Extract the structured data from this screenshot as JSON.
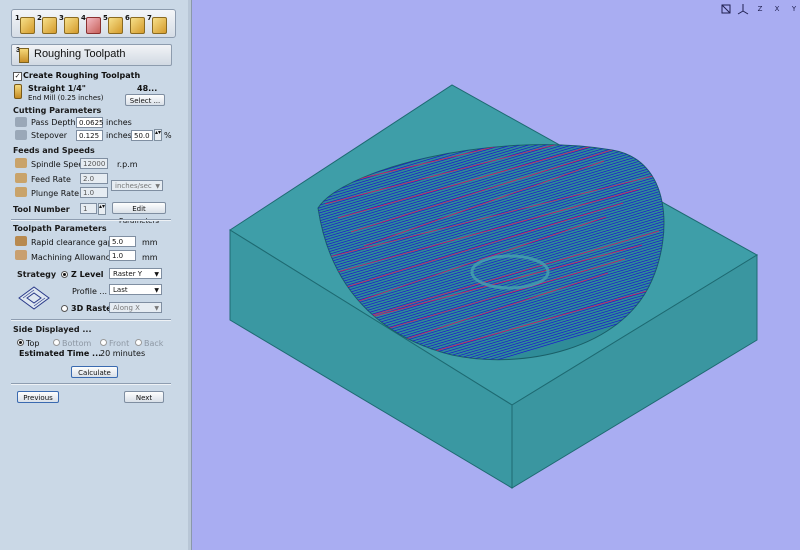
{
  "wizard": {
    "steps": [
      "1",
      "2",
      "3",
      "4",
      "5",
      "6",
      "7"
    ],
    "title_step": "3",
    "title": "Roughing Toolpath"
  },
  "create": {
    "label": "Create Roughing Toolpath",
    "checked": true
  },
  "tool": {
    "name": "Straight 1/4\"",
    "number_display": "48...",
    "type": "End Mill (0.25 inches)",
    "select_label": "Select ..."
  },
  "cutting": {
    "header": "Cutting Parameters",
    "pass_depth_label": "Pass Depth",
    "pass_depth": "0.0625",
    "pass_depth_unit": "inches",
    "stepover_label": "Stepover",
    "stepover": "0.125",
    "stepover_unit": "inches",
    "stepover_pct": "50.0",
    "pct_symbol": "%"
  },
  "feeds": {
    "header": "Feeds and Speeds",
    "spindle_label": "Spindle Speed",
    "spindle": "12000",
    "spindle_unit": "r.p.m",
    "feed_label": "Feed Rate",
    "feed": "2.0",
    "plunge_label": "Plunge Rate",
    "plunge": "1.0",
    "rate_unit": "inches/sec",
    "tool_number_label": "Tool Number",
    "tool_number": "1",
    "edit_params": "Edit Parameters"
  },
  "toolpath": {
    "header": "Toolpath Parameters",
    "rapid_label": "Rapid clearance gap",
    "rapid": "5.0",
    "rapid_unit": "mm",
    "allowance_label": "Machining Allowance",
    "allowance": "1.0",
    "allowance_unit": "mm"
  },
  "strategy": {
    "label": "Strategy",
    "zlevel_label": "Z Level",
    "zlevel_value": "Raster Y",
    "profile_label": "Profile ...",
    "profile_value": "Last",
    "raster3d_label": "3D Raster",
    "raster3d_value": "Along X",
    "selected": "Z Level"
  },
  "side": {
    "header": "Side Displayed ...",
    "options": [
      "Top",
      "Bottom",
      "Front",
      "Back"
    ],
    "selected": "Top",
    "estimate_label": "Estimated Time ...",
    "estimate_value": "20 minutes"
  },
  "buttons": {
    "calculate": "Calculate",
    "previous": "Previous",
    "next": "Next"
  },
  "view_toolbar": {
    "icons": [
      "iso-view-icon",
      "axes-view-icon",
      "z-view-icon",
      "x-view-icon",
      "y-view-icon"
    ],
    "labels": [
      "",
      "",
      "Z",
      "X",
      "Y"
    ]
  },
  "colors": {
    "block": "#3a9aa4",
    "toolpath_blue": "#1a1acc",
    "toolpath_red": "#d02060",
    "background": "#a9adf2"
  }
}
